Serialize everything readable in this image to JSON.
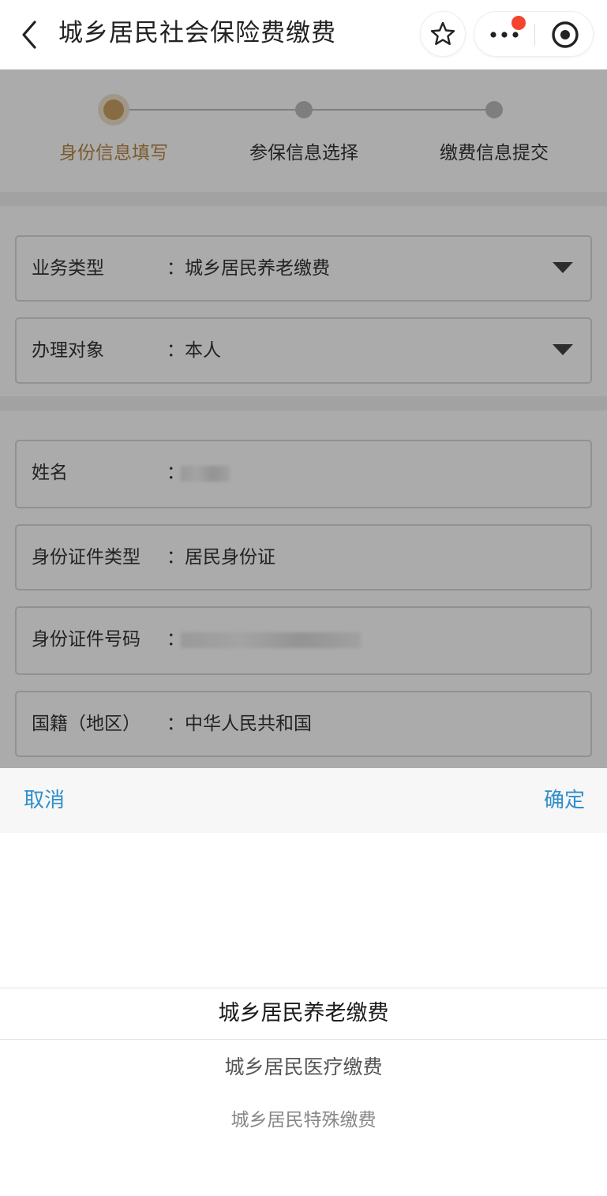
{
  "navbar": {
    "title": "城乡居民社会保险费缴费",
    "back_icon": "chevron-left-icon",
    "favorite_icon": "star-icon",
    "more_icon": "more-dots-icon",
    "close_icon": "target-close-icon"
  },
  "steps": [
    {
      "label": "身份信息填写",
      "active": true
    },
    {
      "label": "参保信息选择",
      "active": false
    },
    {
      "label": "缴费信息提交",
      "active": false
    }
  ],
  "form": {
    "business_type": {
      "label": "业务类型",
      "colon": "：",
      "value": "城乡居民养老缴费"
    },
    "target": {
      "label": "办理对象",
      "colon": "：",
      "value": "本人"
    },
    "name": {
      "label": "姓名",
      "colon": "："
    },
    "id_type": {
      "label": "身份证件类型",
      "colon": "：",
      "value": "居民身份证"
    },
    "id_number": {
      "label": "身份证件号码",
      "colon": "："
    },
    "nationality": {
      "label": "国籍（地区）",
      "colon": "：",
      "value": "中华人民共和国"
    }
  },
  "picker": {
    "cancel_label": "取消",
    "confirm_label": "确定",
    "options": [
      "城乡居民养老缴费",
      "城乡居民医疗缴费",
      "城乡居民特殊缴费"
    ],
    "selected_index": 0
  },
  "colors": {
    "accent": "#c9a063",
    "link": "#2f8ec9",
    "badge": "#f4442e"
  }
}
